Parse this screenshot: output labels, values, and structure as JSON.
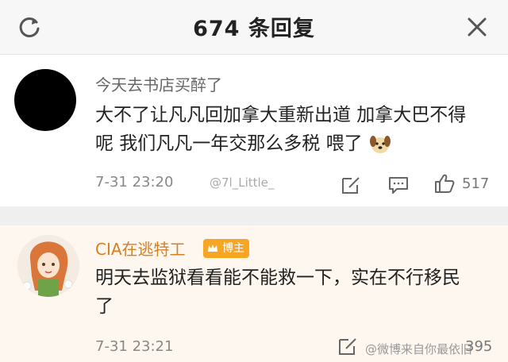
{
  "header": {
    "title": "674 条回复"
  },
  "comments": [
    {
      "username": "今天去书店买醉了",
      "text": "大不了让凡凡回加拿大重新出道 加拿大巴不得呢 我们凡凡一年交那么多税 喂了",
      "time": "7-31 23:20",
      "watermark": "@7l_Little_",
      "likes": "517"
    },
    {
      "username": "CIA在逃特工",
      "badge": "博主",
      "text": "明天去监狱看看能不能救一下，实在不行移民了",
      "time": "7-31 23:21",
      "watermark": "@微博来自你最依旧",
      "likes": "395"
    }
  ],
  "icons": {
    "refresh": "refresh-icon",
    "close": "close-icon",
    "emoji": "dog-emoji-icon",
    "edit": "edit-icon",
    "comment": "comment-icon",
    "like": "thumbs-up-icon",
    "crown": "crown-icon"
  },
  "colors": {
    "header_bg": "#f7f7f7",
    "blogger_name": "#d77f25",
    "badge": "#f6a623",
    "highlight_bg": "#fdf7ef"
  }
}
